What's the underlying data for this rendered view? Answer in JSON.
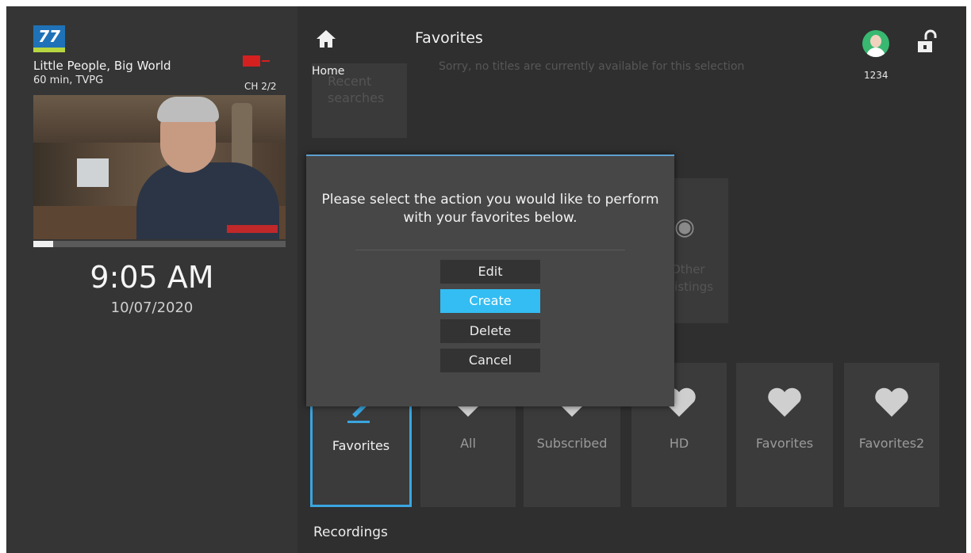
{
  "channel": {
    "logo_text": "77",
    "program_title": "Little People, Big World",
    "program_meta": "60 min, TVPG",
    "channel_number": "CH 2/2",
    "playback_progress": 0.08
  },
  "clock": {
    "time": "9:05 AM",
    "date": "10/07/2020"
  },
  "header": {
    "home_label": "Home",
    "title": "Favorites",
    "background_message": "Sorry, no titles are currently available for this selection",
    "user_id": "1234"
  },
  "tiles": {
    "recent_searches": "Recent searches",
    "other_listings": "Other listings"
  },
  "dialog": {
    "message": "Please select the action you would like to perform with your favorites below.",
    "buttons": [
      "Edit",
      "Create",
      "Delete",
      "Cancel"
    ],
    "active_index": 1
  },
  "favorites_row": {
    "items": [
      {
        "label": "Favorites",
        "icon": "pencil-icon"
      },
      {
        "label": "All",
        "icon": "heart-icon"
      },
      {
        "label": "Subscribed",
        "icon": "heart-icon"
      },
      {
        "label": "HD",
        "icon": "heart-icon"
      },
      {
        "label": "Favorites",
        "icon": "heart-icon"
      },
      {
        "label": "Favorites2",
        "icon": "heart-icon"
      }
    ]
  },
  "sections": {
    "recordings": "Recordings"
  },
  "colors": {
    "accent": "#33bdf2",
    "selected_border": "#3aa6e0",
    "record": "#d52020"
  }
}
